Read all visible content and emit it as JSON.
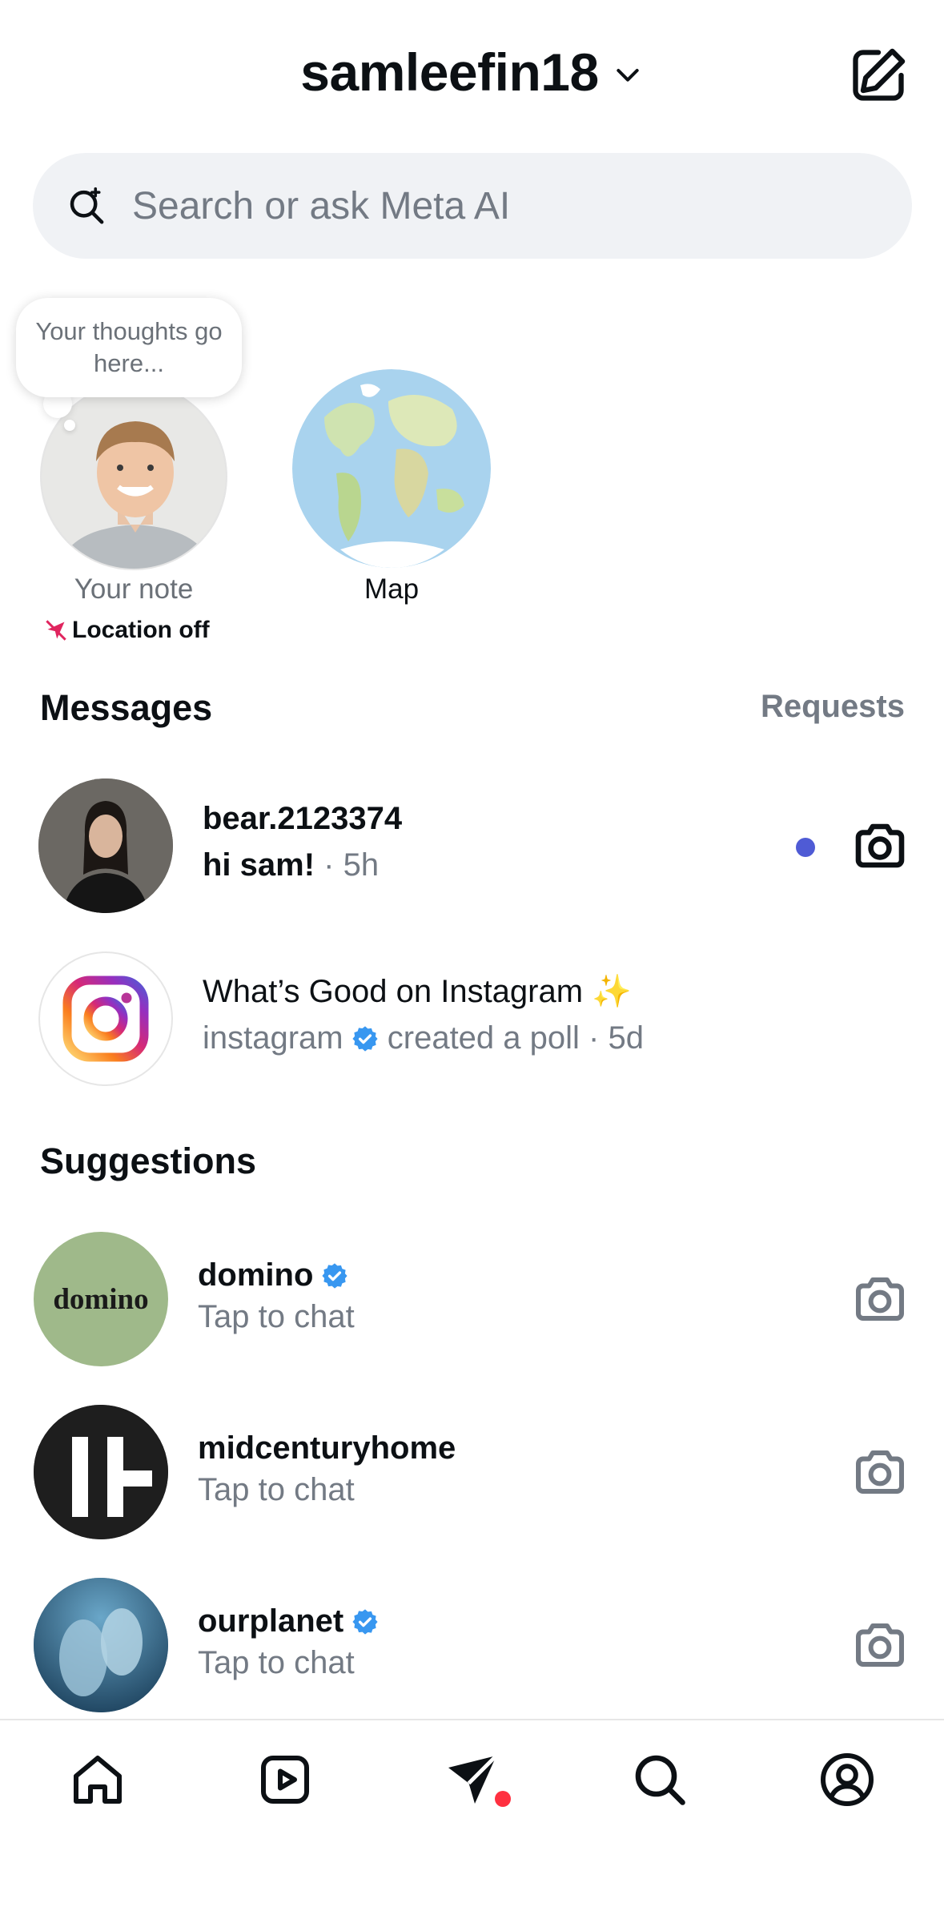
{
  "header": {
    "username": "samleefin18",
    "dropdown_icon": "chevron-down-icon",
    "compose_icon": "compose-icon"
  },
  "search": {
    "placeholder": "Search or ask Meta AI",
    "icon": "meta-ai-search-icon"
  },
  "notes": {
    "bubble_text": "Your thoughts go here...",
    "your_note_label": "Your note",
    "location_status": "Location off",
    "map_label": "Map"
  },
  "messages": {
    "title": "Messages",
    "requests_label": "Requests",
    "threads": [
      {
        "name": "bear.2123374",
        "preview": "hi sam!",
        "time": "· 5h",
        "unread": true
      },
      {
        "name": "What’s Good on Instagram ✨",
        "sender": "instagram",
        "verified": true,
        "preview": "created a poll",
        "time": "· 5d",
        "unread": false
      }
    ]
  },
  "suggestions": {
    "title": "Suggestions",
    "items": [
      {
        "name": "domino",
        "verified": true,
        "subtitle": "Tap to chat",
        "avatar_text": "domino"
      },
      {
        "name": "midcenturyhome",
        "verified": false,
        "subtitle": "Tap to chat"
      },
      {
        "name": "ourplanet",
        "verified": true,
        "subtitle": "Tap to chat"
      }
    ]
  },
  "bottom_nav": {
    "items": [
      "home-icon",
      "reels-icon",
      "messages-icon",
      "search-icon",
      "profile-icon"
    ],
    "active": "messages-icon",
    "notification_color": "#ff3040"
  },
  "colors": {
    "accent_unread": "#4f5bd5",
    "verified": "#3897f0",
    "secondary_text": "#737a84"
  }
}
